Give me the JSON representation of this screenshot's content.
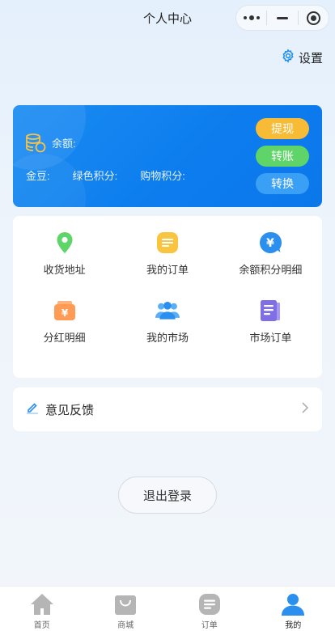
{
  "navbar": {
    "title": "个人中心"
  },
  "settings": {
    "label": "设置"
  },
  "balance_card": {
    "balance_label": "余额:",
    "gold_beans_label": "金豆:",
    "green_points_label": "绿色积分:",
    "shopping_points_label": "购物积分:",
    "buttons": {
      "withdraw": "提现",
      "transfer": "转账",
      "exchange": "转换"
    }
  },
  "menu": {
    "items": [
      {
        "label": "收货地址",
        "icon": "location-pin-icon"
      },
      {
        "label": "我的订单",
        "icon": "order-list-icon"
      },
      {
        "label": "余额积分明细",
        "icon": "yen-coin-icon"
      },
      {
        "label": "分红明细",
        "icon": "dividend-yen-icon"
      },
      {
        "label": "我的市场",
        "icon": "users-group-icon"
      },
      {
        "label": "市场订单",
        "icon": "document-icon"
      }
    ]
  },
  "feedback": {
    "label": "意见反馈"
  },
  "logout": {
    "label": "退出登录"
  },
  "tabbar": {
    "items": [
      {
        "label": "首页",
        "icon": "home-icon"
      },
      {
        "label": "商城",
        "icon": "shopping-bag-icon"
      },
      {
        "label": "订单",
        "icon": "orders-icon"
      },
      {
        "label": "我的",
        "icon": "profile-icon"
      }
    ],
    "active": "我的"
  },
  "colors": {
    "card_blue": "#0c7cee",
    "withdraw_yellow": "#f7bb35",
    "transfer_green": "#5fd468",
    "exchange_blue": "#3aa0f6",
    "active_tab": "#2b8ff0",
    "inactive_tab": "#b5b5b5"
  }
}
